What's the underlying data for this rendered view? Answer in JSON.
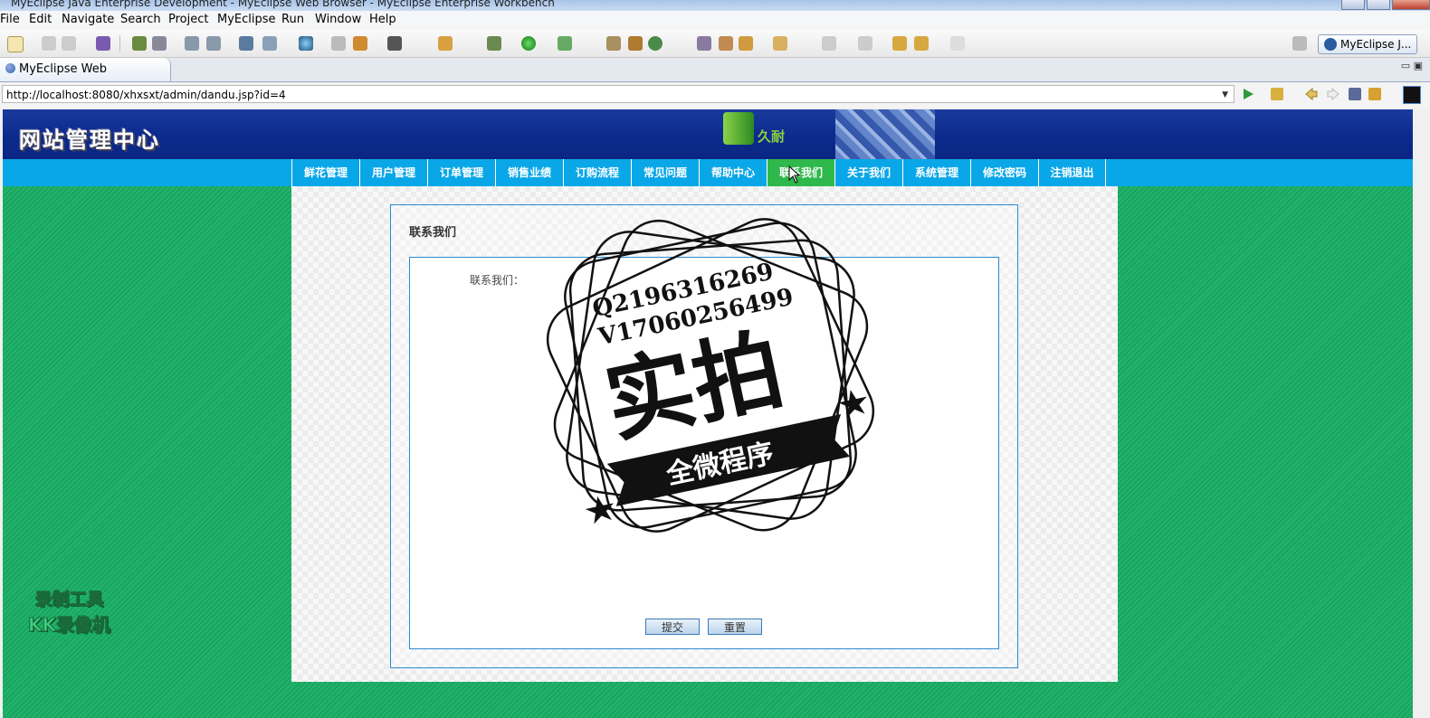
{
  "window": {
    "title": "MyEclipse Java Enterprise Development - MyEclipse Web Browser - MyEclipse Enterprise Workbench"
  },
  "menu": [
    "File",
    "Edit",
    "Navigate",
    "Search",
    "Project",
    "MyEclipse",
    "Run",
    "Window",
    "Help"
  ],
  "toolbar": {
    "perspective_label": "MyEclipse J..."
  },
  "editor_tab": {
    "label": "MyEclipse Web Browser"
  },
  "browser": {
    "url": "http://localhost:8080/xhxsxt/admin/dandu.jsp?id=4"
  },
  "site": {
    "header_title": "网站管理中心",
    "logo_text": "久耐",
    "nav": [
      {
        "label": "鲜花管理"
      },
      {
        "label": "用户管理"
      },
      {
        "label": "订单管理"
      },
      {
        "label": "销售业绩"
      },
      {
        "label": "订购流程"
      },
      {
        "label": "常见问题"
      },
      {
        "label": "帮助中心"
      },
      {
        "label": "联系我们",
        "active": true
      },
      {
        "label": "关于我们"
      },
      {
        "label": "系统管理"
      },
      {
        "label": "修改密码"
      },
      {
        "label": "注销退出"
      }
    ],
    "nav_active_color": "#2fb84b",
    "nav_color": "#0aa7e8",
    "background_color": "#1fb36a"
  },
  "form": {
    "panel_title": "联系我们",
    "field_label": "联系我们：",
    "submit_label": "提交",
    "reset_label": "重置"
  },
  "overlays": {
    "stamp_line1": "Q2196316269",
    "stamp_line2": "V17060256499",
    "stamp_big": "实拍",
    "stamp_banner": "全微程序",
    "recorder_line1": "录制工具",
    "recorder_line2": "KK录像机"
  }
}
